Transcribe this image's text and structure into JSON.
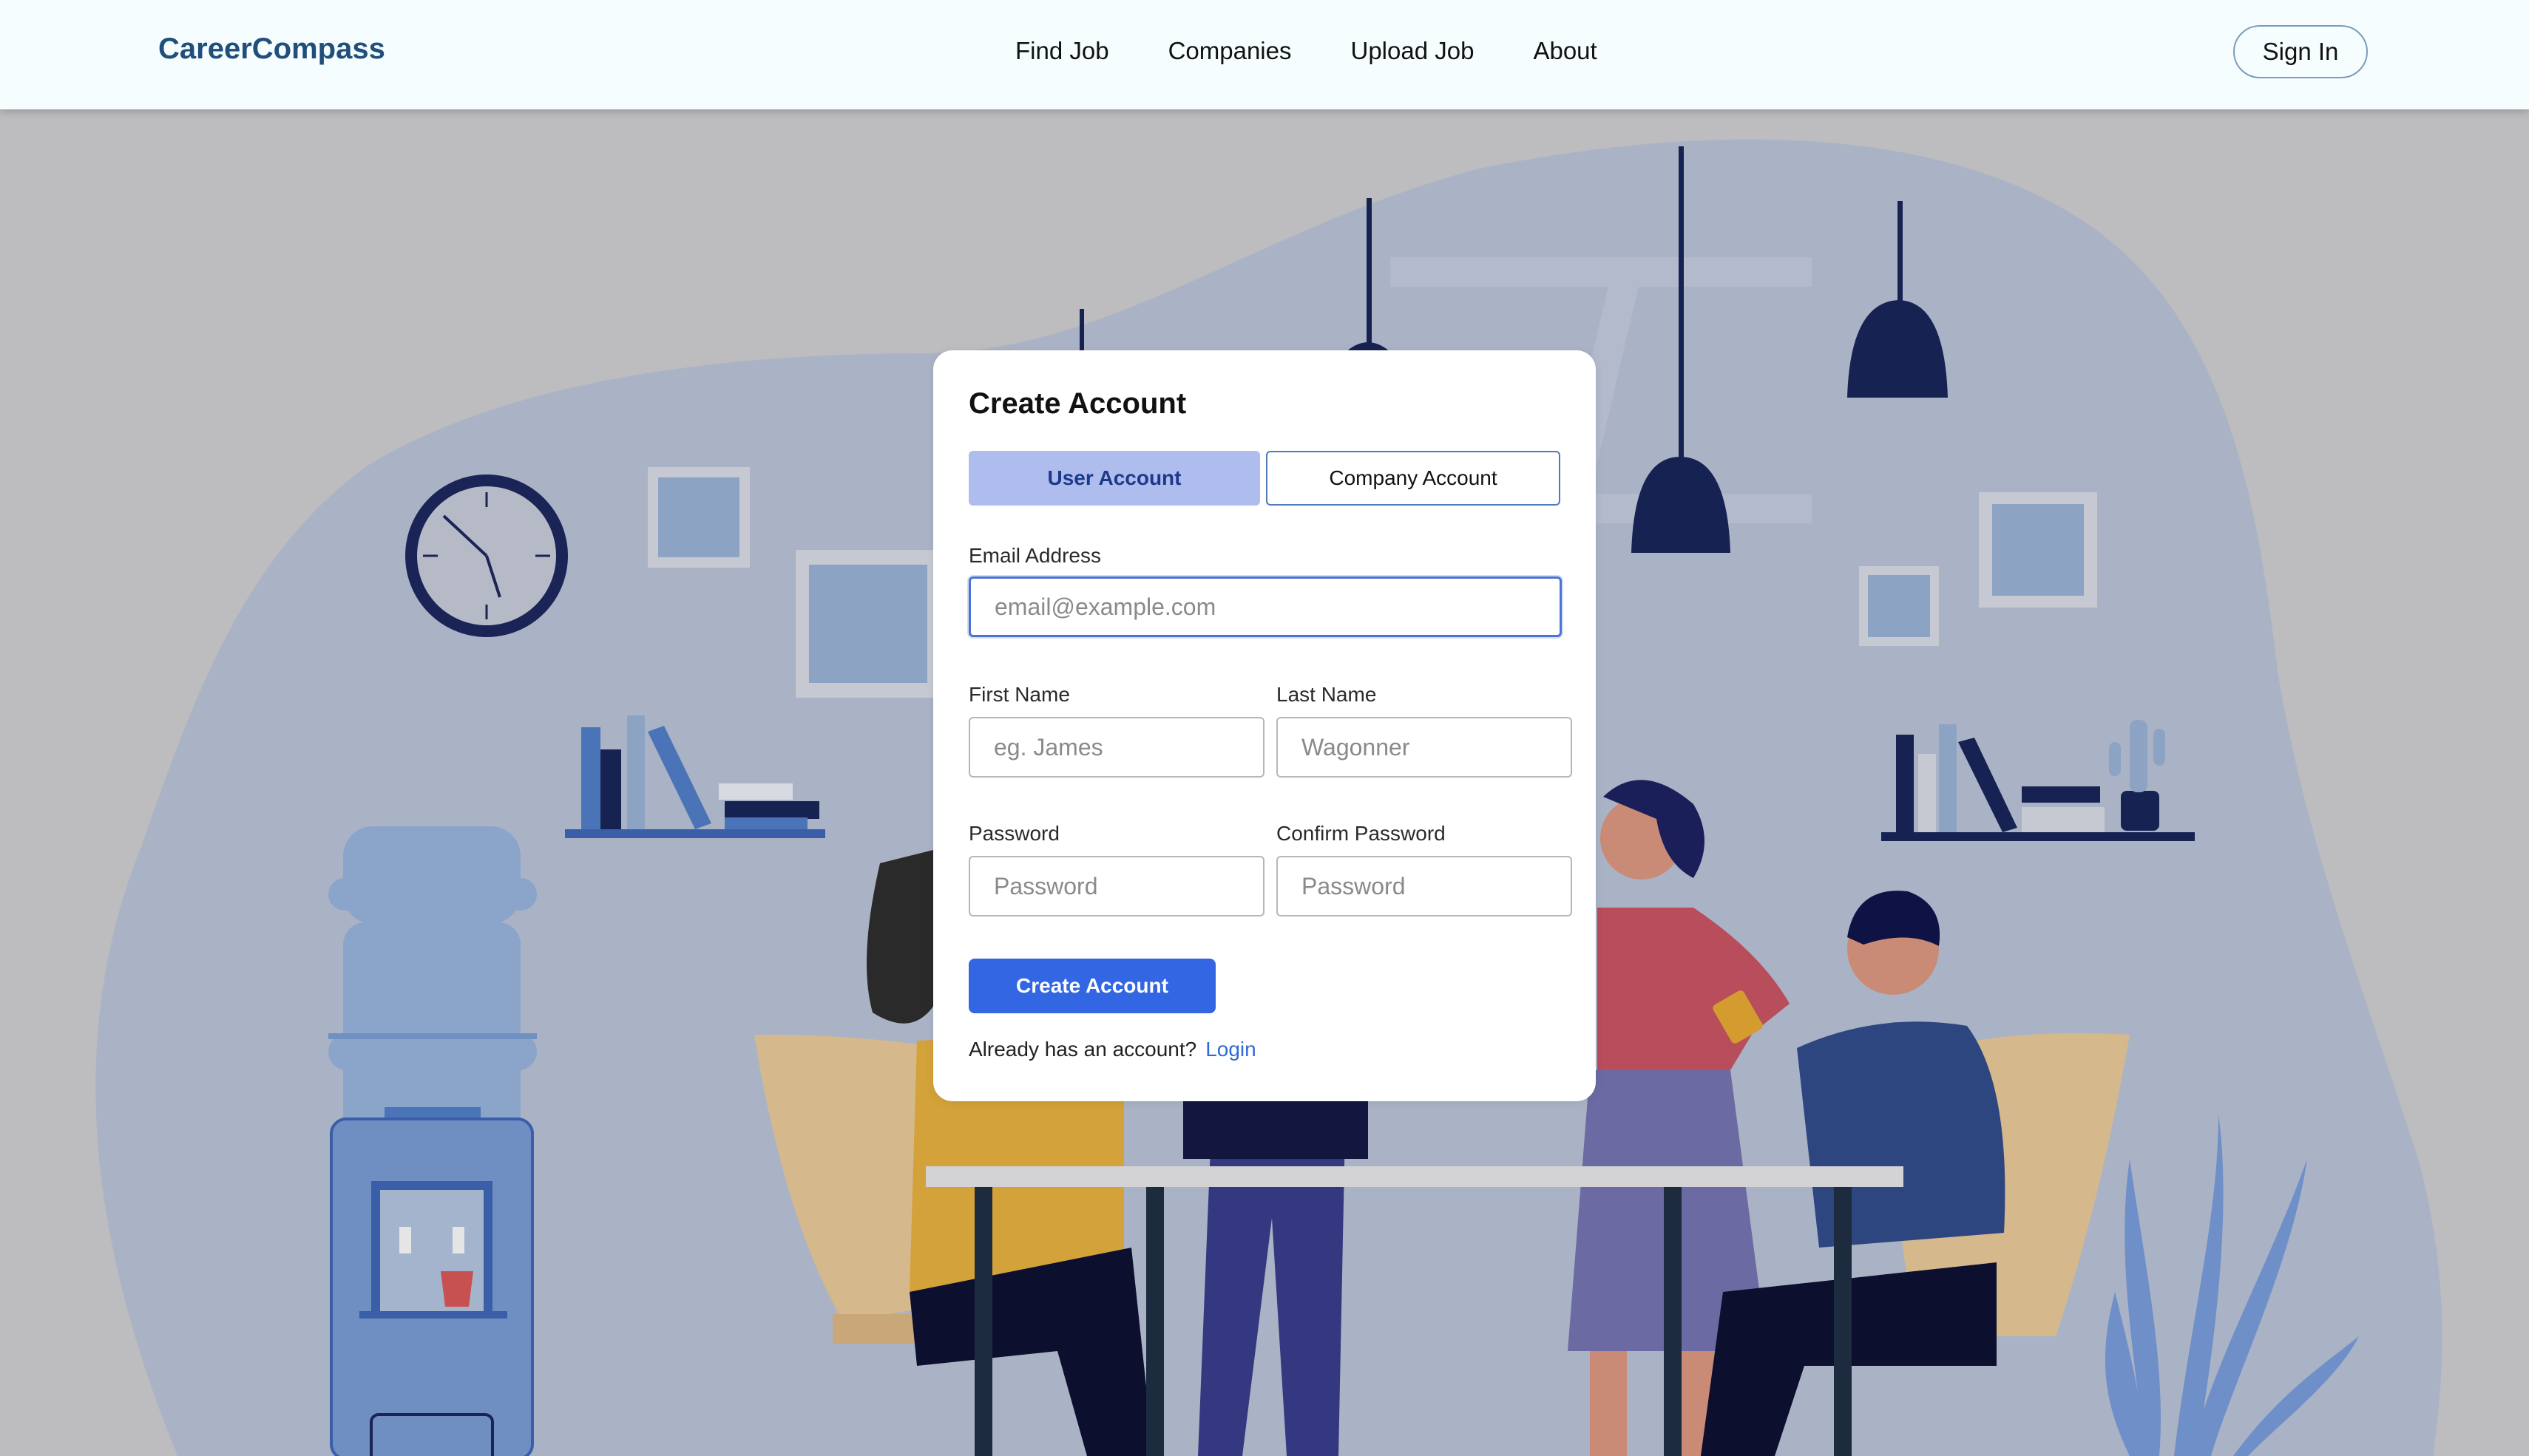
{
  "header": {
    "brand": "CareerCompass",
    "nav": [
      "Find Job",
      "Companies",
      "Upload Job",
      "About"
    ],
    "signin_label": "Sign In"
  },
  "form": {
    "title": "Create Account",
    "tabs": [
      {
        "label": "User Account",
        "active": true
      },
      {
        "label": "Company Account",
        "active": false
      }
    ],
    "email": {
      "label": "Email Address",
      "placeholder": "email@example.com",
      "value": ""
    },
    "first_name": {
      "label": "First Name",
      "placeholder": "eg. James",
      "value": ""
    },
    "last_name": {
      "label": "Last Name",
      "placeholder": "Wagonner",
      "value": ""
    },
    "password": {
      "label": "Password",
      "placeholder": "Password",
      "value": ""
    },
    "confirm_password": {
      "label": "Confirm Password",
      "placeholder": "Password",
      "value": ""
    },
    "submit_label": "Create Account",
    "login_prompt": "Already has an account?",
    "login_link": "Login"
  },
  "colors": {
    "brand": "#1f4f7a",
    "primary_button": "#3266e2",
    "active_tab": "#aebcee",
    "link": "#2e6bd8",
    "background": "#bdbdbf",
    "blob": "#a9b3c6"
  },
  "illustration": {
    "icons": [
      "wall-clock-icon",
      "pendant-lamp-icon",
      "water-cooler-icon",
      "bookshelf-icon",
      "cactus-icon",
      "plant-icon",
      "table-icon",
      "people-illustration"
    ]
  }
}
